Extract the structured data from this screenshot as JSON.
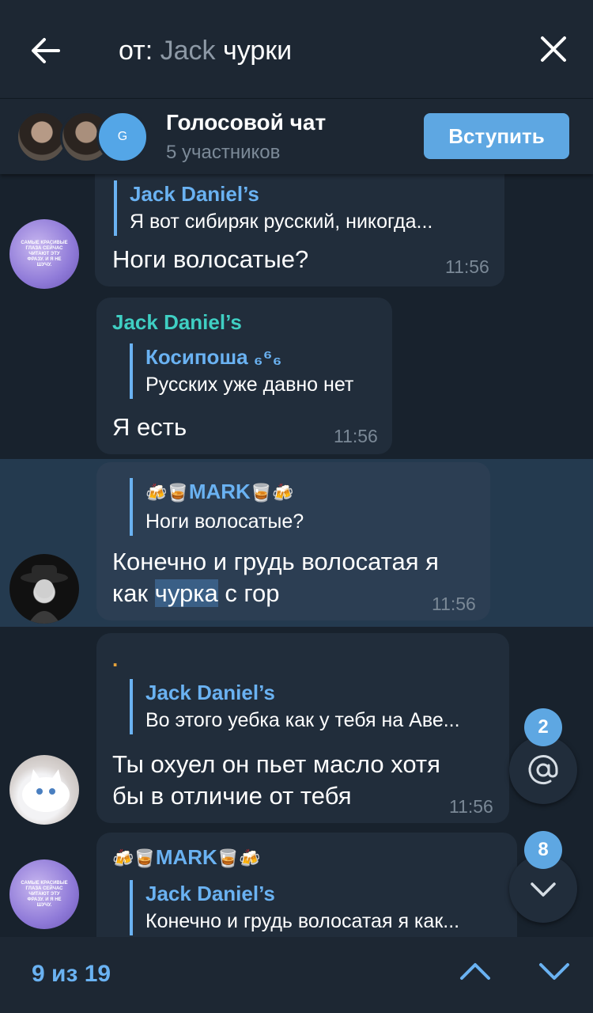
{
  "search": {
    "prefix": "от:",
    "user": "Jack",
    "query": "чурки"
  },
  "voice_chat": {
    "avatar_letter": "G",
    "title": "Голосовой чат",
    "subtitle": "5 участников",
    "join_label": "Вступить"
  },
  "messages": [
    {
      "reply_name": "Jack Daniel’s",
      "reply_text": "Я вот сибиряк русский, никогда...",
      "text": "Ноги волосатые?",
      "time": "11:56",
      "avatar_text": "САМЫЕ КРАСИВЫЕ ГЛАЗА СЕЙЧАС ЧИТАЮТ ЭТУ ФРАЗУ. И Я НЕ ШУЧУ."
    },
    {
      "sender": "Jack Daniel’s",
      "reply_name": "Косипоша ₆⁶₆",
      "reply_text": "Русских уже давно нет",
      "text": "Я есть",
      "time": "11:56"
    },
    {
      "reply_name": "MARK",
      "reply_text": "Ноги волосатые?",
      "text_before": "Конечно и грудь волосатая я",
      "text_line2_before": "как ",
      "text_highlight": "чурка",
      "text_after": " с гор",
      "time": "11:56"
    },
    {
      "sender": ".",
      "reply_name": "Jack Daniel’s",
      "reply_text": "Во этого уебка как у тебя на Аве...",
      "text_line1": "Ты охуел он пьет масло хотя",
      "text_line2": "бы в отличие от тебя",
      "time": "11:56"
    },
    {
      "sender": "MARK",
      "reply_name": "Jack Daniel’s",
      "reply_text": "Конечно и грудь волосатая я как...",
      "avatar_text": "САМЫЕ КРАСИВЫЕ ГЛАЗА СЕЙЧАС ЧИТАЮТ ЭТУ ФРАЗУ. И Я НЕ ШУЧУ."
    }
  ],
  "mentions_badge": "2",
  "scroll_badge": "8",
  "footer": {
    "counter": "9 из 19"
  },
  "colors": {
    "accent": "#6ab2f2",
    "background": "#18222d",
    "bubble": "#212d3b",
    "highlight": "#243a4f",
    "button": "#5ea7e2"
  }
}
